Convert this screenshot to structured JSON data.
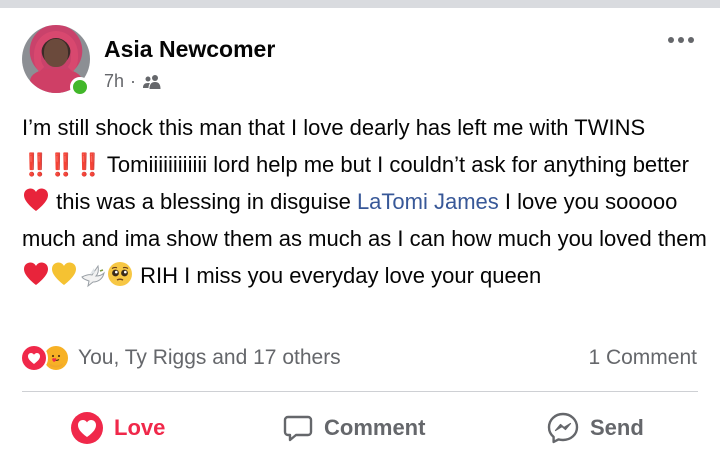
{
  "post": {
    "author": "Asia Newcomer",
    "time": "7h",
    "separator": "·",
    "audience_icon": "friends-icon",
    "text": {
      "p1": "I’m still shock this man that I love dearly has left me with TWINS ",
      "bangs": "‼️‼️‼️",
      "p2": " Tomiiiiiiiiiiii lord help me but I couldn’t ask for anything better ",
      "p3": " this was a blessing in disguise ",
      "mention": "LaTomi James",
      "p4": " I love you sooooo much and ima show them as much as I can how much you loved them ",
      "p5": " RIH I miss you everyday love your queen"
    }
  },
  "reactions": {
    "summary": "You, Ty Riggs and 17 others",
    "comments": "1 Comment",
    "icons": [
      "love-reaction-icon",
      "care-reaction-icon"
    ]
  },
  "actions": {
    "love": "Love",
    "comment": "Comment",
    "send": "Send"
  },
  "colors": {
    "love": "#f0284a",
    "mention": "#385898",
    "muted": "#65676b",
    "online": "#42b72a"
  }
}
